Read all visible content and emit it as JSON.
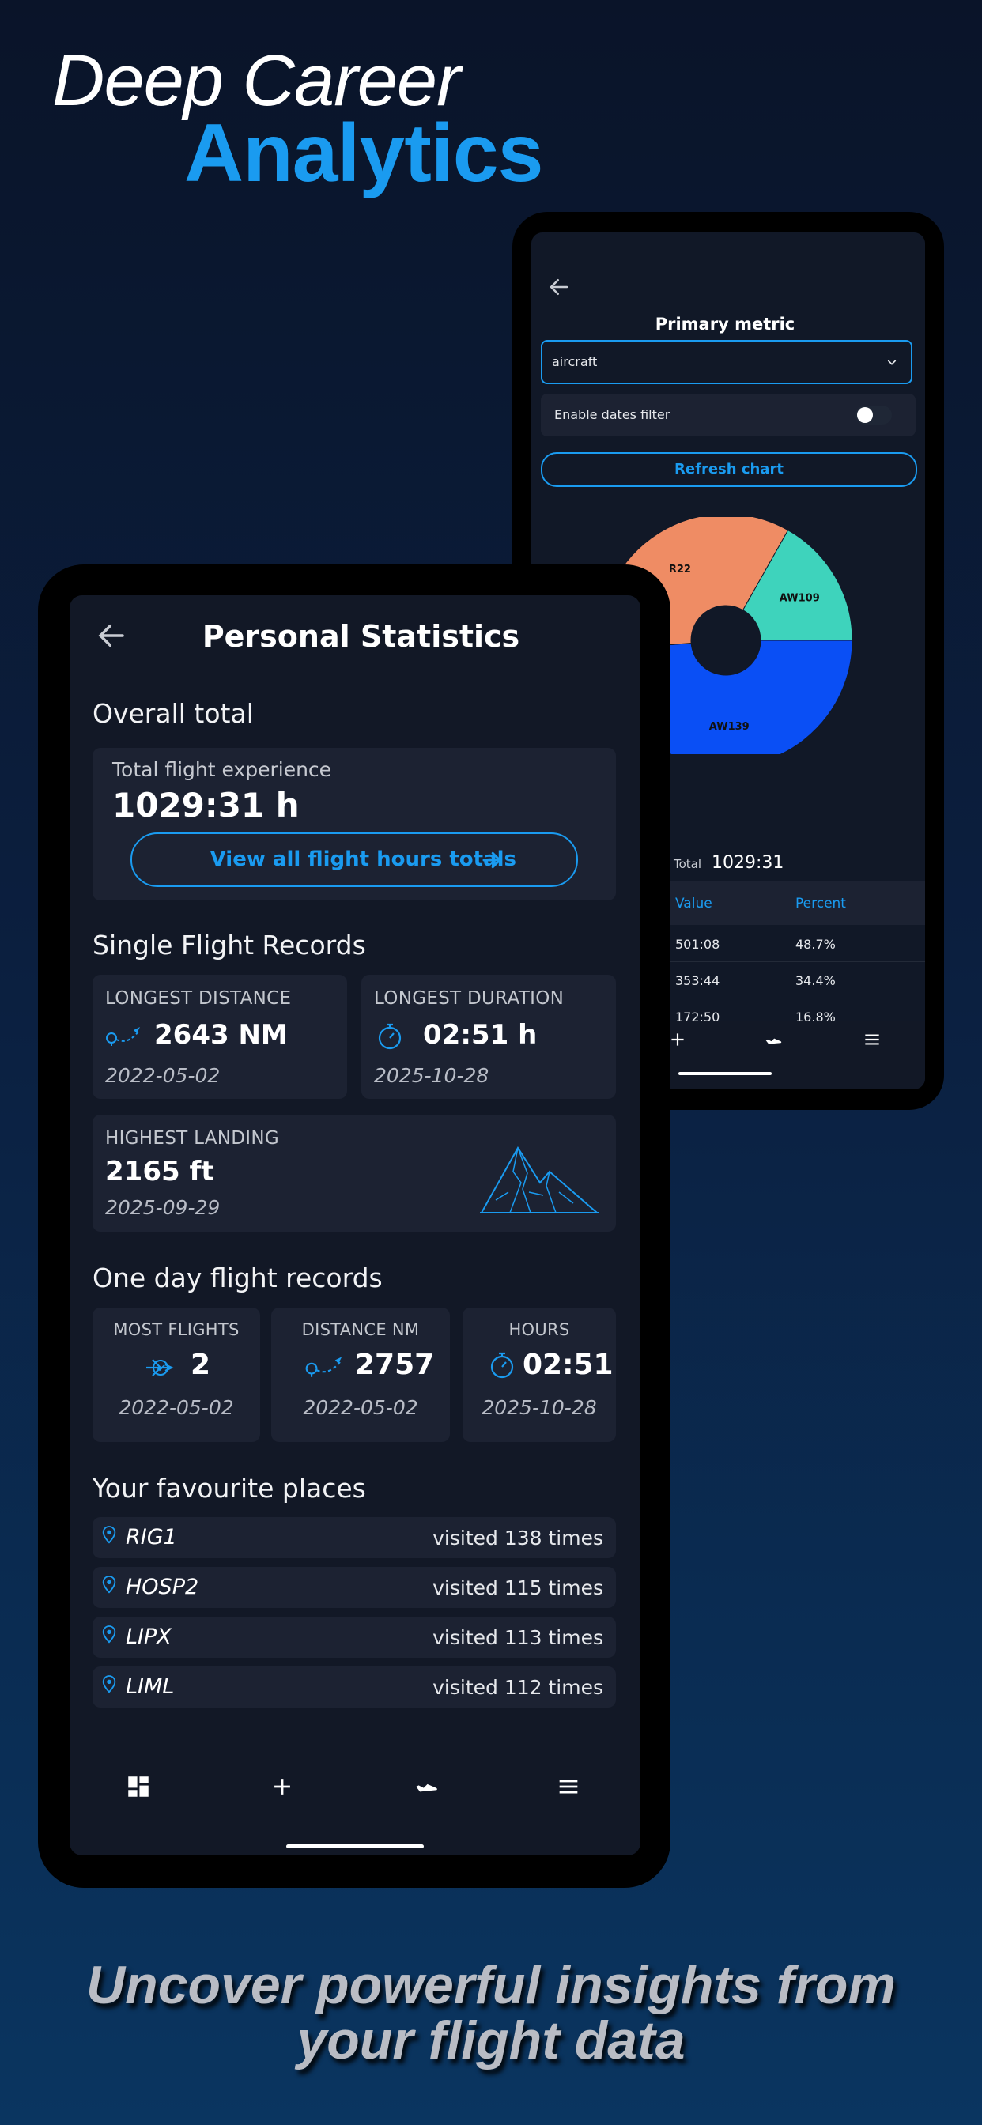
{
  "headline": {
    "line1": "Deep Career",
    "line2": "Analytics"
  },
  "tagline": {
    "line1": "Uncover powerful insights from",
    "line2": "your flight data"
  },
  "chart_screen": {
    "metric_title": "Primary metric",
    "metric_value": "aircraft",
    "dates_filter_label": "Enable dates filter",
    "refresh_label": "Refresh chart",
    "total_label": "Total",
    "total_value": "1029:31",
    "table_headers": [
      "Value",
      "Percent"
    ],
    "rows": [
      {
        "value": "501:08",
        "percent": "48.7%"
      },
      {
        "value": "353:44",
        "percent": "34.4%"
      },
      {
        "value": "172:50",
        "percent": "16.8%"
      }
    ]
  },
  "chart_data": {
    "type": "pie",
    "categories": [
      "AW139",
      "R22",
      "AW109"
    ],
    "values": [
      48.7,
      34.4,
      16.8
    ],
    "colors": [
      "#0a4ff5",
      "#ef8c64",
      "#3ed3bc"
    ]
  },
  "stats": {
    "title": "Personal Statistics",
    "overall": {
      "section": "Overall total",
      "label": "Total flight experience",
      "value": "1029:31 h",
      "button": "View all flight hours totals"
    },
    "single": {
      "section": "Single Flight Records",
      "distance": {
        "label": "LONGEST DISTANCE",
        "value": "2643 NM",
        "date": "2022-05-02"
      },
      "duration": {
        "label": "LONGEST DURATION",
        "value": "02:51 h",
        "date": "2025-10-28"
      },
      "landing": {
        "label": "HIGHEST LANDING",
        "value": "2165 ft",
        "date": "2025-09-29"
      }
    },
    "oneday": {
      "section": "One day flight records",
      "flights": {
        "label": "MOST FLIGHTS",
        "value": "2",
        "date": "2022-05-02"
      },
      "distance": {
        "label": "DISTANCE NM",
        "value": "2757",
        "date": "2022-05-02"
      },
      "hours": {
        "label": "HOURS",
        "value": "02:51",
        "date": "2025-10-28"
      }
    },
    "places": {
      "section": "Your favourite places",
      "items": [
        {
          "name": "RIG1",
          "visits": "visited 138 times"
        },
        {
          "name": "HOSP2",
          "visits": "visited 115 times"
        },
        {
          "name": "LIPX",
          "visits": "visited 113 times"
        },
        {
          "name": "LIML",
          "visits": "visited 112 times"
        }
      ]
    }
  },
  "accent": "#1a9bf0"
}
